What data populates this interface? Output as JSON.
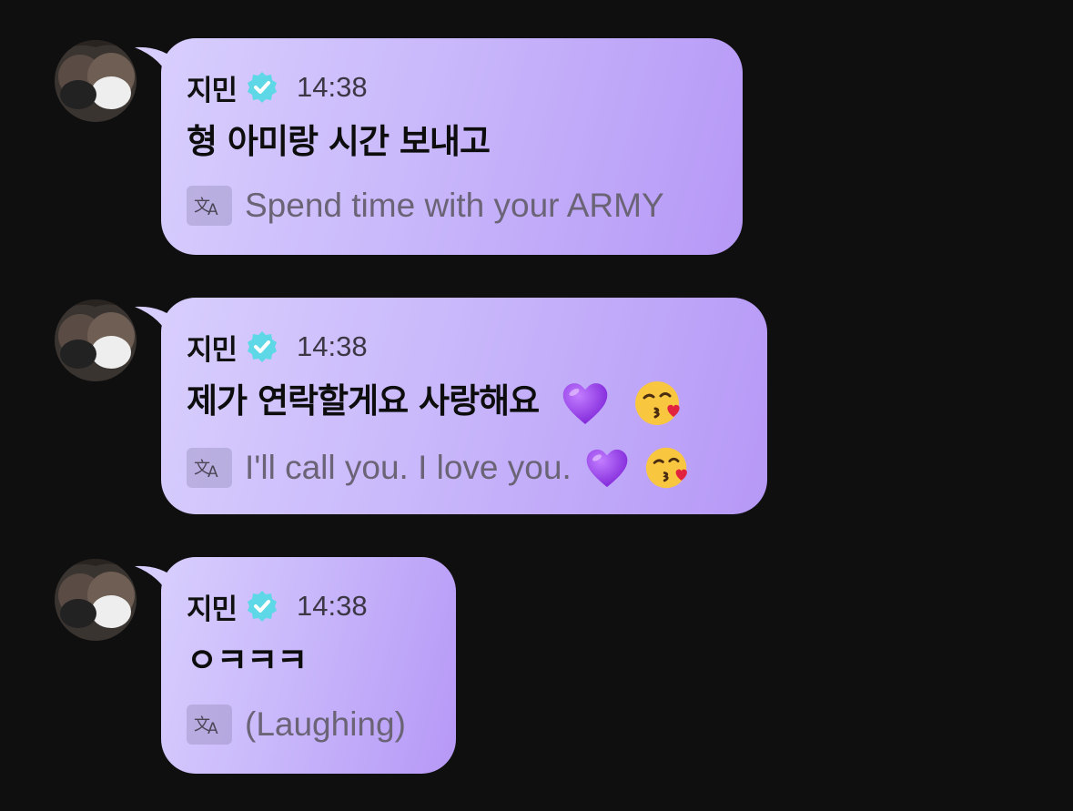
{
  "messages": [
    {
      "sender": "지민",
      "time": "14:38",
      "text": "형 아미랑 시간 보내고",
      "translation": "Spend time with your ARMY",
      "emojis": []
    },
    {
      "sender": "지민",
      "time": "14:38",
      "text": "제가 연락할게요 사랑해요",
      "translation": "I'll call you. I love you.",
      "emojis": [
        "purple-heart",
        "face-blowing-a-kiss"
      ]
    },
    {
      "sender": "지민",
      "time": "14:38",
      "text": "ㅇㅋㅋㅋ",
      "translation": "(Laughing)",
      "emojis": []
    }
  ],
  "colors": {
    "background": "#0f0f10",
    "bubble_start": "#d8cefd",
    "bubble_end": "#b698f6",
    "verified_badge": "#5ed8e6",
    "translation_text": "#6a6476"
  },
  "icons": {
    "verified": "verified-check-icon",
    "translate": "translate-icon"
  }
}
